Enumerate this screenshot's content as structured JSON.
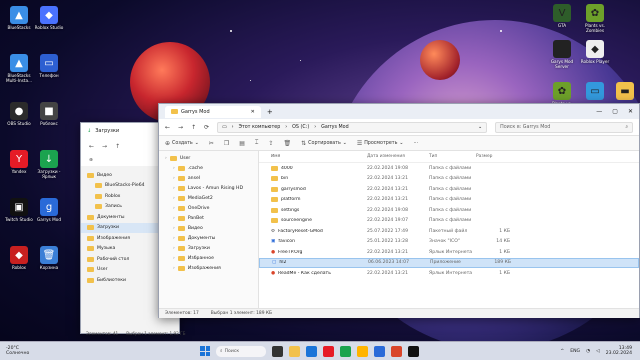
{
  "desktop": {
    "icons_left": [
      {
        "label": "BlueStacks",
        "color": "#3a8ee6",
        "glyph": "▲"
      },
      {
        "label": "Roblox Studio",
        "color": "#4a72ff",
        "glyph": "◆"
      },
      {
        "label": "BlueStacks Multi-Insta...",
        "color": "#3a8ee6",
        "glyph": "▲"
      },
      {
        "label": "Телефон",
        "color": "#2d5fd1",
        "glyph": "▭"
      },
      {
        "label": "OBS Studio",
        "color": "#2b2b2b",
        "glyph": "●"
      },
      {
        "label": "Роблокс",
        "color": "#444",
        "glyph": "■"
      },
      {
        "label": "Yandex",
        "color": "#e61b26",
        "glyph": "Y"
      },
      {
        "label": "Загрузки - Ярлык",
        "color": "#1ba34f",
        "glyph": "↓"
      },
      {
        "label": "Twitch Studio",
        "color": "#111",
        "glyph": "▣"
      },
      {
        "label": "Garrys Mod",
        "color": "#2a6ad8",
        "glyph": "g"
      },
      {
        "label": "Roblox",
        "color": "#c82020",
        "glyph": "◆"
      },
      {
        "label": "Корзина",
        "color": "#3b7fd6",
        "glyph": "🗑"
      }
    ],
    "icons_right": [
      {
        "label": "GTA",
        "color": "#2e5d2a",
        "glyph": "V"
      },
      {
        "label": "Plants vs. Zombies",
        "color": "#6da02a",
        "glyph": "✿"
      },
      {
        "label": "Garys Mod Server",
        "color": "#222",
        "glyph": "▪"
      },
      {
        "label": "Roblox Player",
        "color": "#eeeeee",
        "glyph": "◆"
      },
      {
        "label": "Plants vs. Zombies",
        "color": "#6da02a",
        "glyph": "✿"
      },
      {
        "label": "",
        "color": "#3399dd",
        "glyph": "▭"
      },
      {
        "label": "",
        "color": "#f2c14b",
        "glyph": "▬"
      }
    ]
  },
  "back_window": {
    "title": "Загрузки",
    "sidebar": [
      {
        "label": "Видео",
        "icon": "video-icon",
        "indent": 0
      },
      {
        "label": "BlueStacks-Pie64",
        "icon": "folder-icon",
        "indent": 1
      },
      {
        "label": "Roblox",
        "icon": "folder-icon",
        "indent": 1
      },
      {
        "label": "Запись",
        "icon": "folder-icon",
        "indent": 1
      },
      {
        "label": "Документы",
        "icon": "document-icon",
        "indent": 0
      },
      {
        "label": "Загрузки",
        "icon": "download-icon",
        "indent": 0,
        "active": true
      },
      {
        "label": "Изображения",
        "icon": "image-icon",
        "indent": 0
      },
      {
        "label": "Музыка",
        "icon": "music-icon",
        "indent": 0
      },
      {
        "label": "Рабочий стол",
        "icon": "desktop-icon",
        "indent": 0
      },
      {
        "label": "User",
        "icon": "folder-icon",
        "indent": 0
      },
      {
        "label": "Библиотеки",
        "icon": "folder-icon",
        "indent": 0
      }
    ],
    "status": {
      "count": "Элементов: 41",
      "selected": "Выбран 1 элемент: 1,92 ГБ"
    }
  },
  "main_window": {
    "tab_title": "Garrys Mod",
    "path": [
      "Этот компьютер",
      "OS (C:)",
      "Garrys Mod"
    ],
    "search_placeholder": "Поиск в: Garrys Mod",
    "toolbar": {
      "create": "Создать",
      "sort": "Сортировать",
      "view": "Просмотреть",
      "more": "···"
    },
    "sidebar": [
      {
        "label": "User",
        "indent": 0
      },
      {
        "label": ".cache",
        "indent": 1
      },
      {
        "label": "ansel",
        "indent": 1
      },
      {
        "label": "Lavos - Amun Rising HD",
        "indent": 1
      },
      {
        "label": "MediaGet2",
        "indent": 1
      },
      {
        "label": "OneDrive",
        "indent": 1
      },
      {
        "label": "PanBet",
        "indent": 1
      },
      {
        "label": "Видео",
        "indent": 1
      },
      {
        "label": "Документы",
        "indent": 1
      },
      {
        "label": "Загрузки",
        "indent": 1
      },
      {
        "label": "Избранное",
        "indent": 1
      },
      {
        "label": "Изображения",
        "indent": 1
      }
    ],
    "columns": {
      "name": "Имя",
      "date": "Дата изменения",
      "type": "Тип",
      "size": "Размер"
    },
    "files": [
      {
        "name": "4000",
        "date": "22.02.2024 19:08",
        "type": "Папка с файлами",
        "size": "",
        "kind": "folder"
      },
      {
        "name": "bin",
        "date": "22.02.2024 13:21",
        "type": "Папка с файлами",
        "size": "",
        "kind": "folder"
      },
      {
        "name": "garrysmod",
        "date": "22.02.2024 13:21",
        "type": "Папка с файлами",
        "size": "",
        "kind": "folder"
      },
      {
        "name": "platform",
        "date": "22.02.2024 13:21",
        "type": "Папка с файлами",
        "size": "",
        "kind": "folder"
      },
      {
        "name": "settings",
        "date": "22.02.2024 19:08",
        "type": "Папка с файлами",
        "size": "",
        "kind": "folder"
      },
      {
        "name": "sourceengine",
        "date": "22.02.2024 19:07",
        "type": "Папка с файлами",
        "size": "",
        "kind": "folder"
      },
      {
        "name": "FactoryReset-GMod",
        "date": "25.07.2022 17:49",
        "type": "Пакетный файл",
        "size": "1 КБ",
        "kind": "bat"
      },
      {
        "name": "favicon",
        "date": "25.01.2022 13:28",
        "type": "Значок \"ICO\"",
        "size": "14 КБ",
        "kind": "ico"
      },
      {
        "name": "FreeTP.Org",
        "date": "22.02.2024 13:21",
        "type": "Ярлык Интернета",
        "size": "1 КБ",
        "kind": "url"
      },
      {
        "name": "hl2",
        "date": "06.06.2023 14:07",
        "type": "Приложение",
        "size": "189 КБ",
        "kind": "app",
        "selected": true
      },
      {
        "name": "ReadMe - Как сделать",
        "date": "22.02.2024 13:21",
        "type": "Ярлык Интернета",
        "size": "1 КБ",
        "kind": "url"
      }
    ],
    "status": {
      "count": "Элементов: 17",
      "selected": "Выбран 1 элемент: 189 КБ"
    }
  },
  "taskbar": {
    "weather_temp": "-20°C",
    "weather_desc": "Солнечно",
    "search": "Поиск",
    "lang": "ENG",
    "time": "13:49",
    "date": "23.02.2024"
  }
}
